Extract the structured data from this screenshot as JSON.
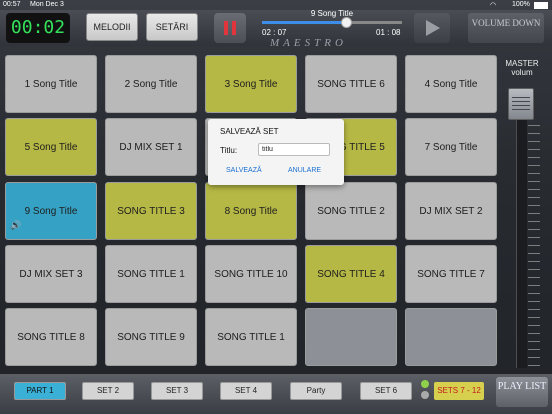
{
  "status_bar": {
    "time": "00:57",
    "date": "Mon Dec 3",
    "battery": "100%"
  },
  "header": {
    "timer": "00:02",
    "melodii_label": "MELODII",
    "setari_label": "SETĂRI",
    "now_playing": "9 Song Title",
    "elapsed": "02 : 07",
    "remaining": "01 : 08",
    "progress": 0.6,
    "volume_down_label": "VOLUME DOWN",
    "brand": "MAESTRO"
  },
  "pads": [
    {
      "label": "1 Song Title",
      "color": "gray"
    },
    {
      "label": "2 Song Title",
      "color": "gray"
    },
    {
      "label": "3 Song Title",
      "color": "yellow"
    },
    {
      "label": "SONG TITLE 6",
      "color": "gray"
    },
    {
      "label": "4 Song Title",
      "color": "gray"
    },
    {
      "label": "5 Song Title",
      "color": "yellow"
    },
    {
      "label": "DJ MIX SET 1",
      "color": "gray"
    },
    {
      "label": "",
      "color": "gray"
    },
    {
      "label": "SONG TITLE 5",
      "color": "yellow"
    },
    {
      "label": "7 Song Title",
      "color": "gray"
    },
    {
      "label": "9 Song Title",
      "color": "blue"
    },
    {
      "label": "SONG TITLE 3",
      "color": "yellow"
    },
    {
      "label": "8 Song Title",
      "color": "yellow"
    },
    {
      "label": "SONG TITLE 2",
      "color": "gray"
    },
    {
      "label": "DJ MIX SET 2",
      "color": "gray"
    },
    {
      "label": "DJ MIX SET 3",
      "color": "gray"
    },
    {
      "label": "SONG TITLE 1",
      "color": "gray"
    },
    {
      "label": "SONG TITLE 10",
      "color": "gray"
    },
    {
      "label": "SONG TITLE 4",
      "color": "yellow"
    },
    {
      "label": "SONG TITLE 7",
      "color": "gray"
    },
    {
      "label": "SONG TITLE 8",
      "color": "gray"
    },
    {
      "label": "SONG TITLE 9",
      "color": "gray"
    },
    {
      "label": "SONG TITLE 1",
      "color": "gray"
    },
    {
      "label": "",
      "color": "empty"
    },
    {
      "label": "",
      "color": "empty"
    }
  ],
  "master": {
    "label": "MASTER volum",
    "level": 1.0
  },
  "sets": {
    "buttons": [
      "PART 1",
      "SET 2",
      "SET 3",
      "SET 4",
      "Party",
      "SET 6"
    ],
    "active_index": 0,
    "range_label": "SETS 7 - 12",
    "playlist_label": "PLAY LIST"
  },
  "dialog": {
    "title": "SALVEAZĂ SET",
    "field_label": "Titlu:",
    "field_value": "titlu",
    "save_label": "SALVEAZĂ",
    "cancel_label": "ANULARE"
  },
  "colors": {
    "gray": "#c9c9c9",
    "yellow": "#c6c84b",
    "blue": "#3ab0d6",
    "accent": "#3ab0d6",
    "timer_text": "#34e05a"
  }
}
